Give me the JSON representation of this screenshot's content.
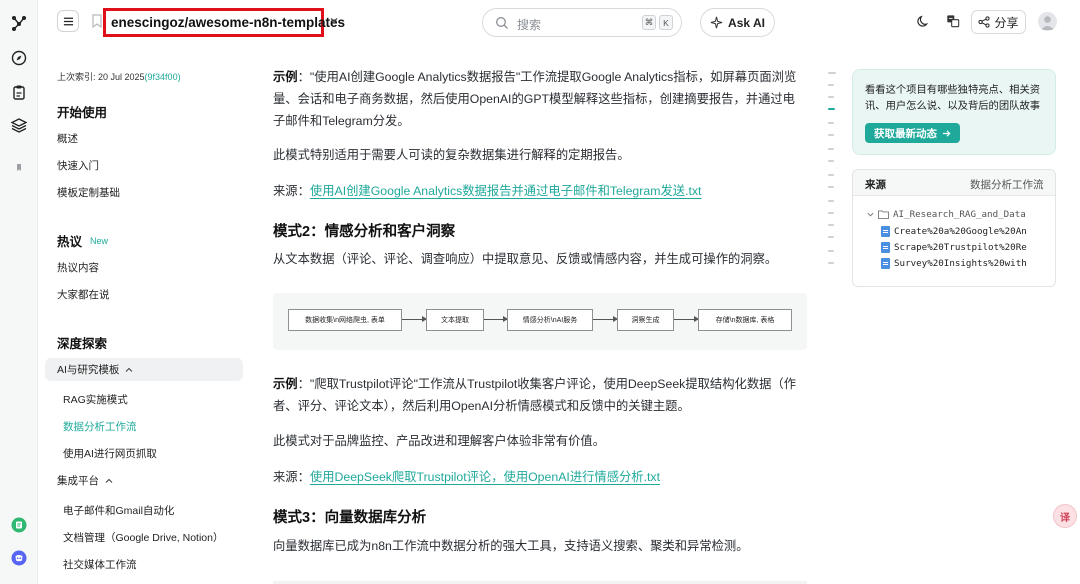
{
  "header": {
    "repo_name": "enescingoz/awesome-n8n-templates",
    "search_placeholder": "搜索",
    "search_key_1": "⌘",
    "search_key_2": "K",
    "ask_ai_label": "Ask AI",
    "share_label": "分享"
  },
  "nav": {
    "last_index_prefix": "上次索引: 20 Jul 2025",
    "last_index_hash": "(9f34f00)",
    "sections": [
      {
        "title": "开始使用",
        "items": [
          "概述",
          "快速入门",
          "模板定制基础"
        ]
      },
      {
        "title": "热议",
        "badge": "New",
        "items": [
          "热议内容",
          "大家都在说"
        ]
      },
      {
        "title": "深度探索"
      }
    ],
    "groups": [
      {
        "label": "AI与研究模板",
        "children": [
          "RAG实施模式",
          "数据分析工作流",
          "使用AI进行网页抓取"
        ]
      },
      {
        "label": "集成平台",
        "children": [
          "电子邮件和Gmail自动化",
          "文档管理（Google Drive, Notion）",
          "社交媒体工作流"
        ]
      }
    ]
  },
  "main": {
    "example1_label": "示例",
    "example1_text": "：\"使用AI创建Google Analytics数据报告\"工作流提取Google Analytics指标，如屏幕页面浏览量、会话和电子商务数据，然后使用OpenAI的GPT模型解释这些指标，创建摘要报告，并通过电子邮件和Telegram分发。",
    "para1": "此模式特别适用于需要人可读的复杂数据集进行解释的定期报告。",
    "source_label": "来源：",
    "source1_link": "使用AI创建Google Analytics数据报告并通过电子邮件和Telegram发送.txt",
    "heading2": "模式2：情感分析和客户洞察",
    "para2": "从文本数据（评论、评论、调查响应）中提取意见、反馈或情感内容，并生成可操作的洞察。",
    "diagram_nodes": [
      "数据收集\\n网络爬虫, 表单",
      "文本提取",
      "情感分析\\nAI服务",
      "洞察生成",
      "存储\\n数据库, 表格"
    ],
    "example2_label": "示例",
    "example2_text": "：\"爬取Trustpilot评论\"工作流从Trustpilot收集客户评论，使用DeepSeek提取结构化数据（作者、评分、评论文本），然后利用OpenAI分析情感模式和反馈中的关键主题。",
    "para3": "此模式对于品牌监控、产品改进和理解客户体验非常有价值。",
    "source2_link": "使用DeepSeek爬取Trustpilot评论，使用OpenAI进行情感分析.txt",
    "heading3": "模式3：向量数据库分析",
    "para4": "向量数据库已成为n8n工作流中数据分析的强大工具，支持语义搜索、聚类和异常检测。"
  },
  "right": {
    "promo_text": "看看这个项目有哪些独特亮点、相关资讯、用户怎么说、以及背后的团队故事",
    "promo_button": "获取最新动态",
    "sources_title": "来源",
    "sources_page": "数据分析工作流",
    "folder": "AI_Research_RAG_and_Data",
    "files": [
      "Create%20a%20Google%20An",
      "Scrape%20Trustpilot%20Re",
      "Survey%20Insights%20with"
    ]
  },
  "float_button": "译",
  "colors": {
    "accent": "#1fa99b",
    "highlight_border": "#e0101a",
    "file_icon": "#4a8fe0"
  }
}
